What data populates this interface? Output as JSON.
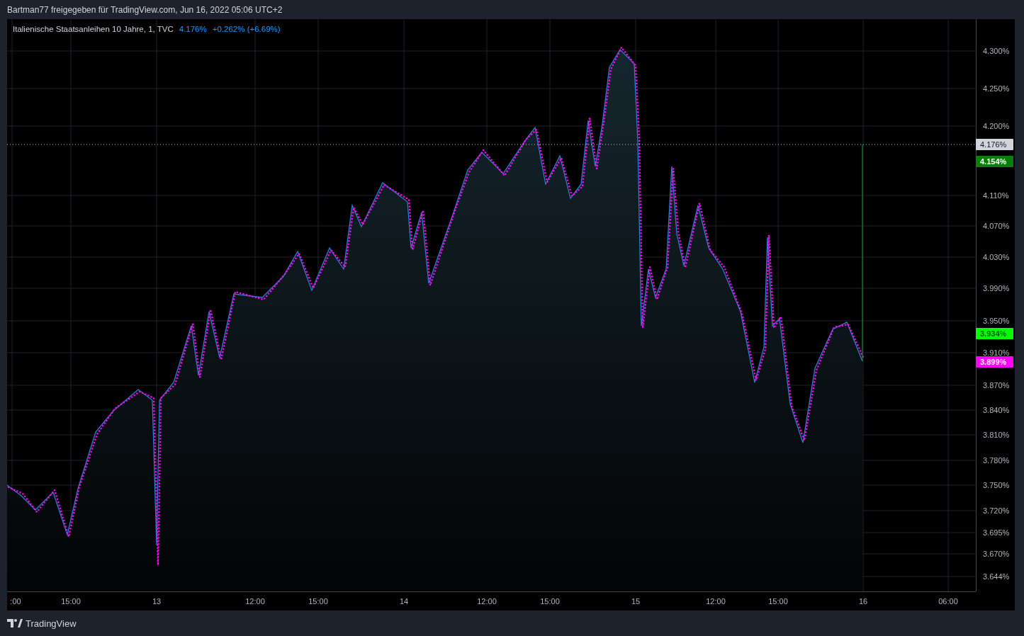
{
  "header": {
    "text": "Bartman77 freigegeben für TradingView.com, Jun 16, 2022 05:06 UTC+2"
  },
  "legend": {
    "title": "Italienische Staatsanleihen 10 Jahre, 1, TVC",
    "price": "4.176%",
    "change": "+0.262% (+6.69%)"
  },
  "chart": {
    "price_axis": [
      "4.300%",
      "4.250%",
      "4.200%",
      "4.110%",
      "4.070%",
      "4.030%",
      "3.990%",
      "3.950%",
      "3.910%",
      "3.870%",
      "3.840%",
      "3.810%",
      "3.780%",
      "3.750%",
      "3.720%",
      "3.695%",
      "3.670%",
      "3.644%"
    ],
    "time_axis": [
      ":00",
      "15:00",
      "13",
      "12:00",
      "15:00",
      "14",
      "12:00",
      "15:00",
      "15",
      "12:00",
      "15:00",
      "16",
      "06:00"
    ],
    "price_markers": [
      {
        "kind": "last",
        "text": "4.176%",
        "color": "#d1d4dc"
      },
      {
        "kind": "marker",
        "text": "4.154%",
        "color": "#0b7d0b"
      },
      {
        "kind": "marker",
        "text": "3.934%",
        "color": "#00ff00"
      },
      {
        "kind": "marker",
        "text": "3.899%",
        "color": "#ff00ff"
      }
    ]
  },
  "footer": {
    "logo": "TradingView"
  }
}
